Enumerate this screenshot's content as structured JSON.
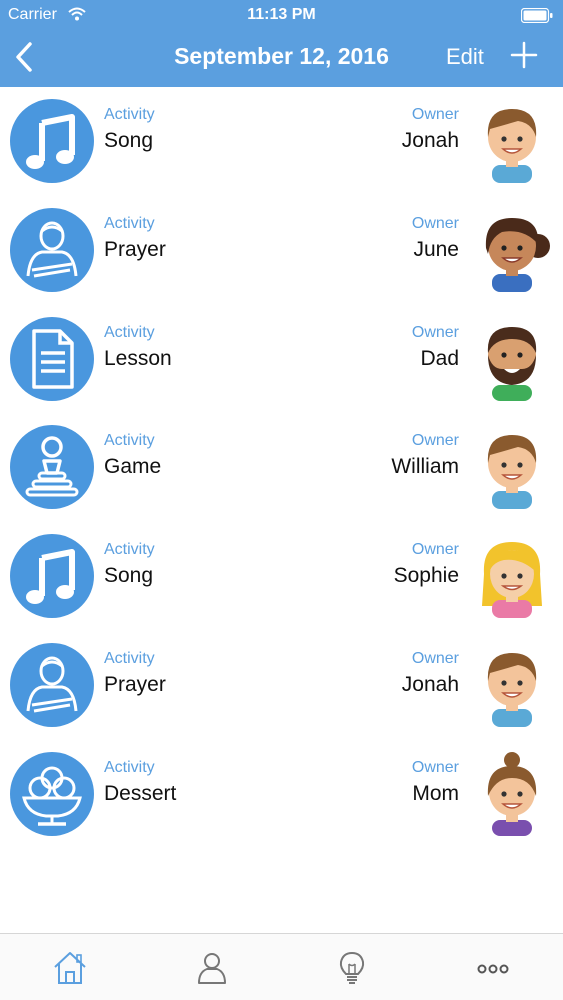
{
  "status_bar": {
    "carrier": "Carrier",
    "time": "11:13 PM"
  },
  "nav": {
    "title": "September 12, 2016",
    "edit_label": "Edit"
  },
  "colors": {
    "accent": "#5b9fdf",
    "text": "#111111"
  },
  "rows": [
    {
      "activity_label": "Activity",
      "activity": "Song",
      "activity_icon": "music-note-icon",
      "owner_label": "Owner",
      "owner": "Jonah",
      "avatar": "boy-avatar"
    },
    {
      "activity_label": "Activity",
      "activity": "Prayer",
      "activity_icon": "praying-person-icon",
      "owner_label": "Owner",
      "owner": "June",
      "avatar": "woman-avatar"
    },
    {
      "activity_label": "Activity",
      "activity": "Lesson",
      "activity_icon": "document-icon",
      "owner_label": "Owner",
      "owner": "Dad",
      "avatar": "bearded-man-avatar"
    },
    {
      "activity_label": "Activity",
      "activity": "Game",
      "activity_icon": "game-piece-icon",
      "owner_label": "Owner",
      "owner": "William",
      "avatar": "boy-avatar"
    },
    {
      "activity_label": "Activity",
      "activity": "Song",
      "activity_icon": "music-note-icon",
      "owner_label": "Owner",
      "owner": "Sophie",
      "avatar": "blonde-girl-avatar"
    },
    {
      "activity_label": "Activity",
      "activity": "Prayer",
      "activity_icon": "praying-person-icon",
      "owner_label": "Owner",
      "owner": "Jonah",
      "avatar": "boy-avatar"
    },
    {
      "activity_label": "Activity",
      "activity": "Dessert",
      "activity_icon": "ice-cream-bowl-icon",
      "owner_label": "Owner",
      "owner": "Mom",
      "avatar": "woman-bun-avatar"
    }
  ],
  "tabs": [
    {
      "name": "home",
      "icon": "home-icon"
    },
    {
      "name": "people",
      "icon": "person-icon"
    },
    {
      "name": "ideas",
      "icon": "lightbulb-icon"
    },
    {
      "name": "more",
      "icon": "more-icon"
    }
  ]
}
